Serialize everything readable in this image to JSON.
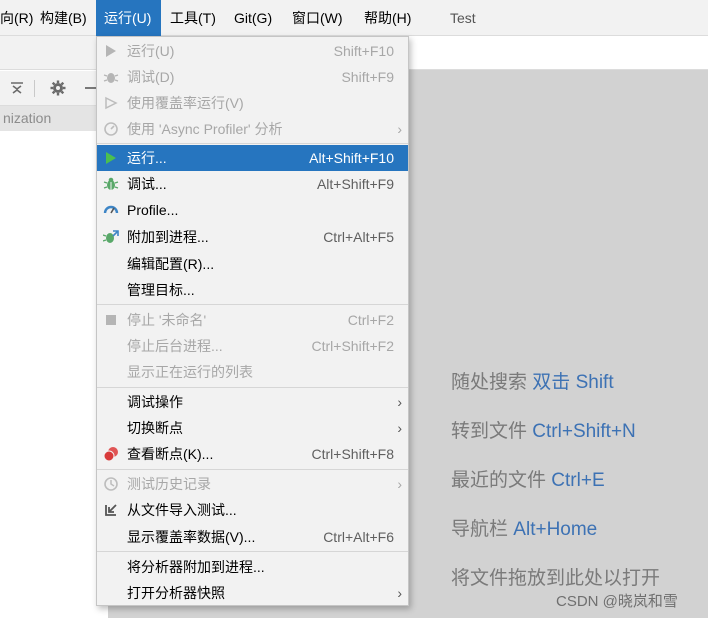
{
  "menubar": {
    "items": [
      {
        "label": "向(R)"
      },
      {
        "label": "构建(B)"
      },
      {
        "label": "运行(U)"
      },
      {
        "label": "工具(T)"
      },
      {
        "label": "Git(G)"
      },
      {
        "label": "窗口(W)"
      },
      {
        "label": "帮助(H)"
      }
    ],
    "project_title": "Test"
  },
  "left_panel": {
    "header_text": "nization"
  },
  "run_menu": {
    "items": [
      {
        "label": "运行(U)",
        "shortcut": "Shift+F10",
        "icon": "run-triangle-icon",
        "enabled": false
      },
      {
        "label": "调试(D)",
        "shortcut": "Shift+F9",
        "icon": "debug-bug-icon",
        "enabled": false
      },
      {
        "label": "使用覆盖率运行(V)",
        "shortcut": "",
        "icon": "coverage-icon",
        "enabled": false
      },
      {
        "label": "使用 'Async Profiler' 分析",
        "shortcut": "",
        "icon": "profiler-icon",
        "enabled": false,
        "submenu": true
      },
      {
        "label": "运行...",
        "shortcut": "Alt+Shift+F10",
        "icon": "run-triangle-icon",
        "enabled": true,
        "selected": true
      },
      {
        "label": "调试...",
        "shortcut": "Alt+Shift+F9",
        "icon": "debug-bug-icon",
        "enabled": true
      },
      {
        "label": "Profile...",
        "shortcut": "",
        "icon": "profile-gauge-icon",
        "enabled": true
      },
      {
        "label": "附加到进程...",
        "shortcut": "Ctrl+Alt+F5",
        "icon": "attach-debugger-icon",
        "enabled": true
      },
      {
        "label": "编辑配置(R)...",
        "shortcut": "",
        "icon": "",
        "enabled": true
      },
      {
        "label": "管理目标...",
        "shortcut": "",
        "icon": "",
        "enabled": true
      },
      {
        "label": "停止 '未命名'",
        "shortcut": "Ctrl+F2",
        "icon": "stop-square-icon",
        "enabled": false
      },
      {
        "label": "停止后台进程...",
        "shortcut": "Ctrl+Shift+F2",
        "icon": "",
        "enabled": false
      },
      {
        "label": "显示正在运行的列表",
        "shortcut": "",
        "icon": "",
        "enabled": false
      },
      {
        "label": "调试操作",
        "shortcut": "",
        "icon": "",
        "enabled": true,
        "submenu": true
      },
      {
        "label": "切换断点",
        "shortcut": "",
        "icon": "",
        "enabled": true,
        "submenu": true
      },
      {
        "label": "查看断点(K)...",
        "shortcut": "Ctrl+Shift+F8",
        "icon": "breakpoints-icon",
        "enabled": true
      },
      {
        "label": "测试历史记录",
        "shortcut": "",
        "icon": "history-clock-icon",
        "enabled": false,
        "submenu": true
      },
      {
        "label": "从文件导入测试...",
        "shortcut": "",
        "icon": "import-arrow-icon",
        "enabled": true
      },
      {
        "label": "显示覆盖率数据(V)...",
        "shortcut": "Ctrl+Alt+F6",
        "icon": "",
        "enabled": true
      },
      {
        "label": "将分析器附加到进程...",
        "shortcut": "",
        "icon": "",
        "enabled": true
      },
      {
        "label": "打开分析器快照",
        "shortcut": "",
        "icon": "",
        "enabled": true,
        "submenu": true
      }
    ]
  },
  "editor_hints": [
    {
      "text": "随处搜索",
      "key": "双击 Shift"
    },
    {
      "text": "转到文件",
      "key": "Ctrl+Shift+N"
    },
    {
      "text": "最近的文件",
      "key": "Ctrl+E"
    },
    {
      "text": "导航栏",
      "key": "Alt+Home"
    },
    {
      "text": "将文件拖放到此处以打开",
      "key": ""
    }
  ],
  "watermark": "CSDN @晓岚和雪",
  "colors": {
    "selection": "#2675bf",
    "menu_bg": "#f2f2f2",
    "editor_bg": "#d2d2d2",
    "hint_key": "#3d72b4"
  }
}
